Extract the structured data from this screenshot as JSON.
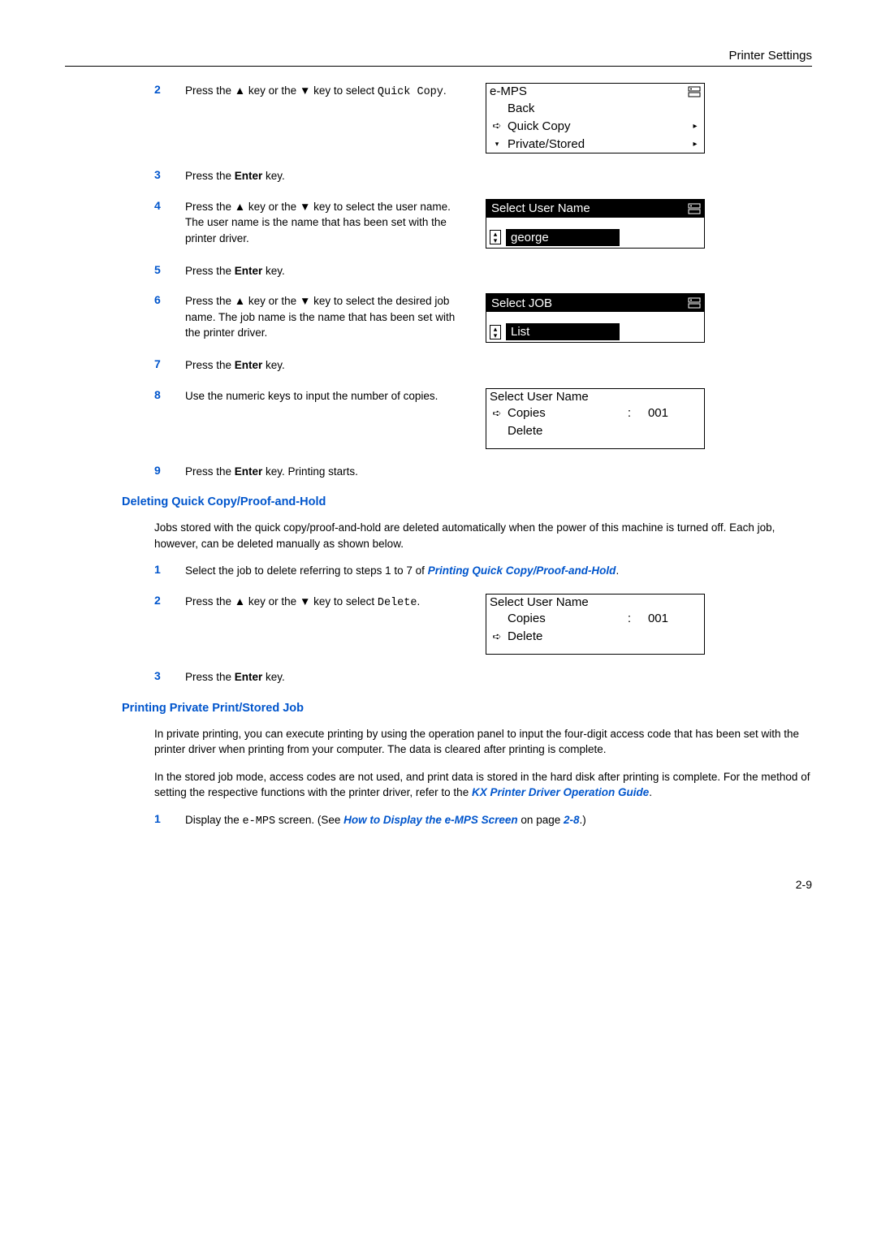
{
  "header": {
    "title": "Printer Settings"
  },
  "steps": {
    "s2": {
      "n": "2",
      "prefix": "Press the ",
      "k1": "▲",
      "mid1": " key or the ",
      "k2": "▼",
      "mid2": " key to select ",
      "code": "Quick Copy",
      "end": "."
    },
    "s3": {
      "n": "3",
      "prefix": "Press the ",
      "key": "Enter",
      "end": " key."
    },
    "s4": {
      "n": "4",
      "prefix": "Press the ",
      "k1": "▲",
      "mid1": " key or the ",
      "k2": "▼",
      "end": " key to select the user name. The user name is the name that has been set with the printer driver."
    },
    "s5": {
      "n": "5",
      "prefix": "Press the ",
      "key": "Enter",
      "end": " key."
    },
    "s6": {
      "n": "6",
      "prefix": "Press the ",
      "k1": "▲",
      "mid1": " key or the ",
      "k2": "▼",
      "end": " key to select the desired job name. The job name is the name that has been set with the printer driver."
    },
    "s7": {
      "n": "7",
      "prefix": "Press the ",
      "key": "Enter",
      "end": " key."
    },
    "s8": {
      "n": "8",
      "text": "Use the numeric keys to input the number of copies."
    },
    "s9": {
      "n": "9",
      "prefix": "Press the ",
      "key": "Enter",
      "end": " key. Printing starts."
    },
    "d1": {
      "n": "1",
      "prefix": "Select the job to delete referring to steps 1 to 7 of ",
      "link": "Printing Quick Copy/Proof-and-Hold",
      "end": "."
    },
    "d2": {
      "n": "2",
      "prefix": "Press the ",
      "k1": "▲",
      "mid1": " key or the ",
      "k2": "▼",
      "mid2": " key to select ",
      "code": "Delete",
      "end": "."
    },
    "d3": {
      "n": "3",
      "prefix": "Press the ",
      "key": "Enter",
      "end": " key."
    },
    "p1": {
      "n": "1",
      "prefix": "Display the ",
      "code": "e-MPS",
      "mid": " screen. (See ",
      "link": "How to Display the e-MPS Screen",
      "onpage": " on page ",
      "page": "2-8",
      "end": ".)"
    }
  },
  "displays": {
    "emps": {
      "title": "e-MPS",
      "items": [
        "Back",
        "Quick Copy",
        "Private/Stored"
      ],
      "selected": 1
    },
    "user": {
      "title": "Select User Name",
      "item": "george"
    },
    "job": {
      "title": "Select JOB",
      "item": "List"
    },
    "copies": {
      "title": "Select User Name",
      "line1": "Copies",
      "value": "001",
      "line2": "Delete",
      "pointer": 0
    },
    "delete": {
      "title": "Select User Name",
      "line1": "Copies",
      "value": "001",
      "line2": "Delete",
      "pointer": 1
    }
  },
  "sections": {
    "del_heading": "Deleting Quick Copy/Proof-and-Hold",
    "del_para": "Jobs stored with the quick copy/proof-and-hold are deleted automatically when the power of this machine is turned off. Each job, however, can be deleted manually as shown below.",
    "priv_heading": "Printing Private Print/Stored Job",
    "priv_para1": "In private printing, you can execute printing by using the operation panel to input the four-digit access code that has been set with the printer driver when printing from your computer. The data is cleared after printing is complete.",
    "priv_para2_pre": "In the stored job mode, access codes are not used, and print data is stored in the hard disk after printing is complete. For the method of setting the respective functions with the printer driver, refer to the ",
    "priv_link": "KX Printer Driver Operation Guide",
    "priv_para2_post": "."
  },
  "footer": {
    "page": "2-9"
  }
}
